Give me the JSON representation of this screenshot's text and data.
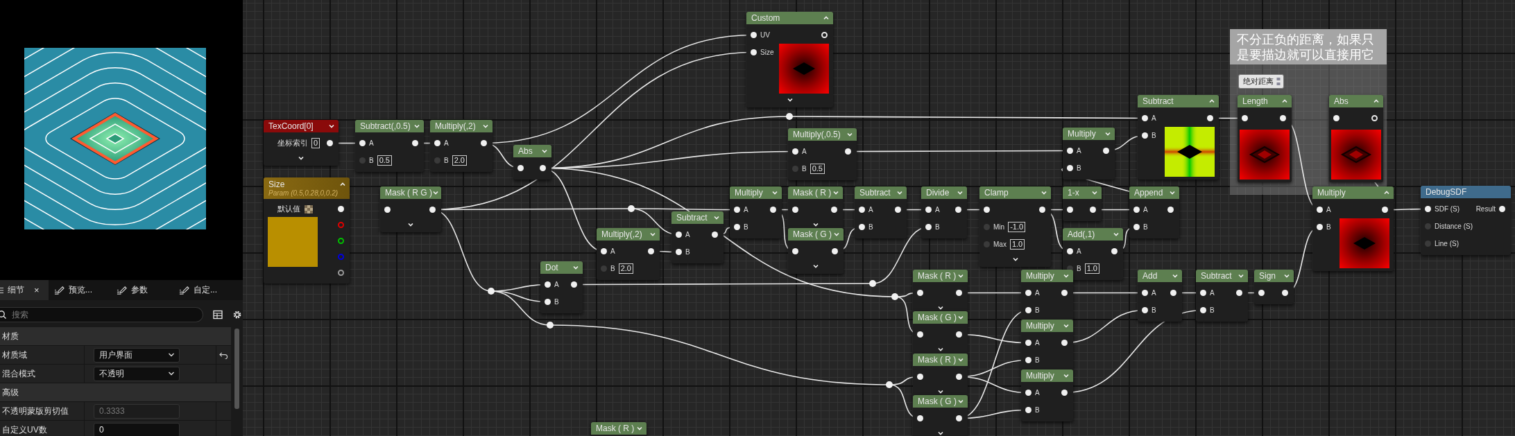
{
  "preview": {
    "kind": "picture"
  },
  "details": {
    "tabs": [
      {
        "label": "细节",
        "selected": true,
        "close": "×"
      },
      {
        "label": "预览...",
        "selected": false
      },
      {
        "label": "参数",
        "selected": false
      },
      {
        "label": "自定...",
        "selected": false
      }
    ],
    "search": {
      "placeholder": "搜索"
    },
    "sections": [
      {
        "title": "材质",
        "rows": [
          {
            "label": "材质域",
            "kind": "dropdown",
            "value": "用户界面",
            "modified": true
          },
          {
            "label": "混合模式",
            "kind": "dropdown",
            "value": "不透明",
            "modified": false
          }
        ]
      },
      {
        "title": "高级",
        "rows": [
          {
            "label": "不透明蒙版剪切值",
            "kind": "number",
            "value": "0.3333",
            "disabled": true
          },
          {
            "label": "自定义UV数",
            "kind": "number",
            "value": "0",
            "disabled": false
          }
        ]
      }
    ]
  },
  "graph": {
    "comment": {
      "text": "不分正负的距离，如果只是要描边就可以直接用它"
    },
    "nodes": [
      {
        "kind": "coordinate",
        "title": "TexCoord[0]",
        "expanded": false,
        "advanced": true,
        "property": {
          "label": "坐标索引",
          "value": "0"
        },
        "outputs": [
          {
            "connected": true
          }
        ]
      },
      {
        "kind": "function",
        "title": "Subtract(,0.5)",
        "expanded": false,
        "inputs": [
          {
            "label": "A",
            "connected": true
          },
          {
            "label": "B",
            "connected": false,
            "value": "0.5"
          }
        ],
        "outputs": [
          {
            "connected": true
          }
        ]
      },
      {
        "kind": "function",
        "title": "Multiply(,2)",
        "expanded": false,
        "inputs": [
          {
            "label": "A",
            "connected": true
          },
          {
            "label": "B",
            "connected": false,
            "value": "2.0"
          }
        ],
        "outputs": [
          {
            "connected": true
          }
        ]
      },
      {
        "kind": "function",
        "title": "Abs",
        "expanded": false,
        "inputs": [
          {
            "connected": true
          }
        ],
        "outputs": [
          {
            "connected": true
          }
        ]
      },
      {
        "kind": "parameter",
        "title": "Size",
        "subtitle": "Param (0.5,0.28,0,0.2)",
        "expanded": true,
        "color": "#b98f00",
        "property": {
          "label": "默认值"
        },
        "outputs": [
          {
            "connected": true
          },
          {
            "connected": false,
            "color": "#e00000"
          },
          {
            "connected": false,
            "color": "#00c000"
          },
          {
            "connected": false,
            "color": "#0000e0"
          },
          {
            "connected": false,
            "color": "#9a9a9a"
          }
        ]
      },
      {
        "kind": "function",
        "title": "Mask ( R G )",
        "expanded": false,
        "advanced": true,
        "inputs": [
          {
            "connected": true
          }
        ],
        "outputs": [
          {
            "connected": true
          }
        ]
      },
      {
        "kind": "function",
        "title": "Custom",
        "expanded": true,
        "advanced": true,
        "preview": {
          "kind": "picture"
        },
        "inputs": [
          {
            "label": "UV",
            "connected": true
          },
          {
            "label": "Size",
            "connected": true
          }
        ],
        "outputs": [
          {
            "connected": false
          }
        ]
      },
      {
        "kind": "function",
        "title": "Multiply(,0.5)",
        "expanded": false,
        "inputs": [
          {
            "label": "A",
            "connected": true
          },
          {
            "label": "B",
            "connected": false,
            "value": "0.5"
          }
        ],
        "outputs": [
          {
            "connected": true
          }
        ]
      },
      {
        "kind": "function",
        "title": "Multiply",
        "expanded": false,
        "inputs": [
          {
            "label": "A",
            "connected": true
          },
          {
            "label": "B",
            "connected": true
          }
        ],
        "outputs": [
          {
            "connected": true
          }
        ]
      },
      {
        "kind": "function",
        "title": "Mask ( R )",
        "expanded": false,
        "advanced": true,
        "inputs": [
          {
            "connected": true
          }
        ],
        "outputs": [
          {
            "connected": true
          }
        ]
      },
      {
        "kind": "function",
        "title": "Mask ( G )",
        "expanded": false,
        "advanced": true,
        "inputs": [
          {
            "connected": true
          }
        ],
        "outputs": [
          {
            "connected": true
          }
        ]
      },
      {
        "kind": "function",
        "title": "Subtract",
        "expanded": false,
        "inputs": [
          {
            "label": "A",
            "connected": true
          },
          {
            "label": "B",
            "connected": true
          }
        ],
        "outputs": [
          {
            "connected": true
          }
        ]
      },
      {
        "kind": "function",
        "title": "Divide",
        "expanded": false,
        "inputs": [
          {
            "label": "A",
            "connected": true
          },
          {
            "label": "B",
            "connected": true
          }
        ],
        "outputs": [
          {
            "connected": true
          }
        ]
      },
      {
        "kind": "function",
        "title": "Clamp",
        "expanded": false,
        "advanced": true,
        "inputs": [
          {
            "connected": true
          },
          {
            "label": "Min",
            "connected": false,
            "value": "-1.0"
          },
          {
            "label": "Max",
            "connected": false,
            "value": "1.0"
          }
        ],
        "outputs": [
          {
            "connected": true
          }
        ]
      },
      {
        "kind": "function",
        "title": "Subtract",
        "expanded": false,
        "inputs": [
          {
            "label": "A",
            "connected": true
          },
          {
            "label": "B",
            "connected": true
          }
        ],
        "outputs": [
          {
            "connected": true
          }
        ]
      },
      {
        "kind": "function",
        "title": "Multiply(,2)",
        "expanded": false,
        "inputs": [
          {
            "label": "A",
            "connected": true
          },
          {
            "label": "B",
            "connected": false,
            "value": "2.0"
          }
        ],
        "outputs": [
          {
            "connected": true
          }
        ]
      },
      {
        "kind": "function",
        "title": "Dot",
        "expanded": false,
        "inputs": [
          {
            "label": "A",
            "connected": true
          },
          {
            "label": "B",
            "connected": true
          }
        ],
        "outputs": [
          {
            "connected": true
          }
        ]
      },
      {
        "kind": "function",
        "title": "Multiply",
        "expanded": false,
        "inputs": [
          {
            "label": "A",
            "connected": true
          },
          {
            "label": "B",
            "connected": true
          }
        ],
        "outputs": [
          {
            "connected": true
          }
        ]
      },
      {
        "kind": "function",
        "title": "1-x",
        "expanded": false,
        "inputs": [
          {
            "connected": true
          }
        ],
        "outputs": [
          {
            "connected": true
          }
        ]
      },
      {
        "kind": "function",
        "title": "Append",
        "expanded": false,
        "inputs": [
          {
            "label": "A",
            "connected": true
          },
          {
            "label": "B",
            "connected": true
          }
        ],
        "outputs": [
          {
            "connected": true
          }
        ]
      },
      {
        "kind": "function",
        "title": "Add(,1)",
        "expanded": false,
        "inputs": [
          {
            "label": "A",
            "connected": true
          },
          {
            "label": "B",
            "connected": false,
            "value": "1.0"
          }
        ],
        "outputs": [
          {
            "connected": true
          }
        ]
      },
      {
        "kind": "function",
        "title": "Subtract",
        "expanded": true,
        "preview": {
          "kind": "picture"
        },
        "inputs": [
          {
            "label": "A",
            "connected": true
          },
          {
            "label": "B",
            "connected": true
          }
        ],
        "outputs": [
          {
            "connected": true
          }
        ]
      },
      {
        "kind": "function",
        "title": "Length",
        "expanded": true,
        "preview": {
          "kind": "picture"
        },
        "bubble": "绝对距离",
        "inputs": [
          {
            "connected": true
          }
        ],
        "outputs": [
          {
            "connected": true
          }
        ]
      },
      {
        "kind": "function",
        "title": "Abs",
        "expanded": true,
        "preview": {
          "kind": "picture"
        },
        "inputs": [
          {
            "connected": true
          }
        ],
        "outputs": [
          {
            "connected": false
          }
        ]
      },
      {
        "kind": "function",
        "title": "Multiply",
        "expanded": true,
        "preview": {
          "kind": "picture"
        },
        "inputs": [
          {
            "label": "A",
            "connected": true
          },
          {
            "label": "B",
            "connected": true
          }
        ],
        "outputs": [
          {
            "connected": true
          }
        ]
      },
      {
        "kind": "call",
        "title": "DebugSDF",
        "inputs": [
          {
            "label": "SDF (S)",
            "connected": true
          },
          {
            "label": "Distance (S)",
            "connected": false
          },
          {
            "label": "Line (S)",
            "connected": false
          }
        ],
        "outputs": [
          {
            "label": "Result",
            "connected": true
          }
        ]
      },
      {
        "kind": "function",
        "title": "Mask ( R )",
        "expanded": false,
        "advanced": true,
        "inputs": [
          {
            "connected": true
          }
        ],
        "outputs": [
          {
            "connected": true
          }
        ]
      },
      {
        "kind": "function",
        "title": "Mask ( G )",
        "expanded": false,
        "advanced": true,
        "inputs": [
          {
            "connected": true
          }
        ],
        "outputs": [
          {
            "connected": true
          }
        ]
      },
      {
        "kind": "function",
        "title": "Mask ( R )",
        "expanded": false,
        "advanced": true,
        "inputs": [
          {
            "connected": true
          }
        ],
        "outputs": [
          {
            "connected": true
          }
        ]
      },
      {
        "kind": "function",
        "title": "Mask ( G )",
        "expanded": false,
        "advanced": true,
        "inputs": [
          {
            "connected": true
          }
        ],
        "outputs": [
          {
            "connected": true
          }
        ]
      },
      {
        "kind": "function",
        "title": "Multiply",
        "expanded": false,
        "inputs": [
          {
            "label": "A",
            "connected": true
          },
          {
            "label": "B",
            "connected": true
          }
        ],
        "outputs": [
          {
            "connected": true
          }
        ]
      },
      {
        "kind": "function",
        "title": "Multiply",
        "expanded": false,
        "inputs": [
          {
            "label": "A",
            "connected": true
          },
          {
            "label": "B",
            "connected": true
          }
        ],
        "outputs": [
          {
            "connected": true
          }
        ]
      },
      {
        "kind": "function",
        "title": "Multiply",
        "expanded": false,
        "inputs": [
          {
            "label": "A",
            "connected": true
          },
          {
            "label": "B",
            "connected": true
          }
        ],
        "outputs": [
          {
            "connected": true
          }
        ]
      },
      {
        "kind": "function",
        "title": "Add",
        "expanded": false,
        "inputs": [
          {
            "label": "A",
            "connected": true
          },
          {
            "label": "B",
            "connected": true
          }
        ],
        "outputs": [
          {
            "connected": true
          }
        ]
      },
      {
        "kind": "function",
        "title": "Subtract",
        "expanded": false,
        "inputs": [
          {
            "label": "A",
            "connected": true
          },
          {
            "label": "B",
            "connected": true
          }
        ],
        "outputs": [
          {
            "connected": true
          }
        ]
      },
      {
        "kind": "function",
        "title": "Sign",
        "expanded": false,
        "inputs": [
          {
            "connected": true
          }
        ],
        "outputs": [
          {
            "connected": true
          }
        ]
      },
      {
        "kind": "function",
        "title": "Mask ( R )",
        "expanded": false
      },
      {
        "kind": "reroute"
      },
      {
        "kind": "reroute"
      },
      {
        "kind": "reroute"
      },
      {
        "kind": "reroute"
      },
      {
        "kind": "reroute"
      },
      {
        "kind": "reroute"
      },
      {
        "kind": "reroute"
      }
    ]
  }
}
